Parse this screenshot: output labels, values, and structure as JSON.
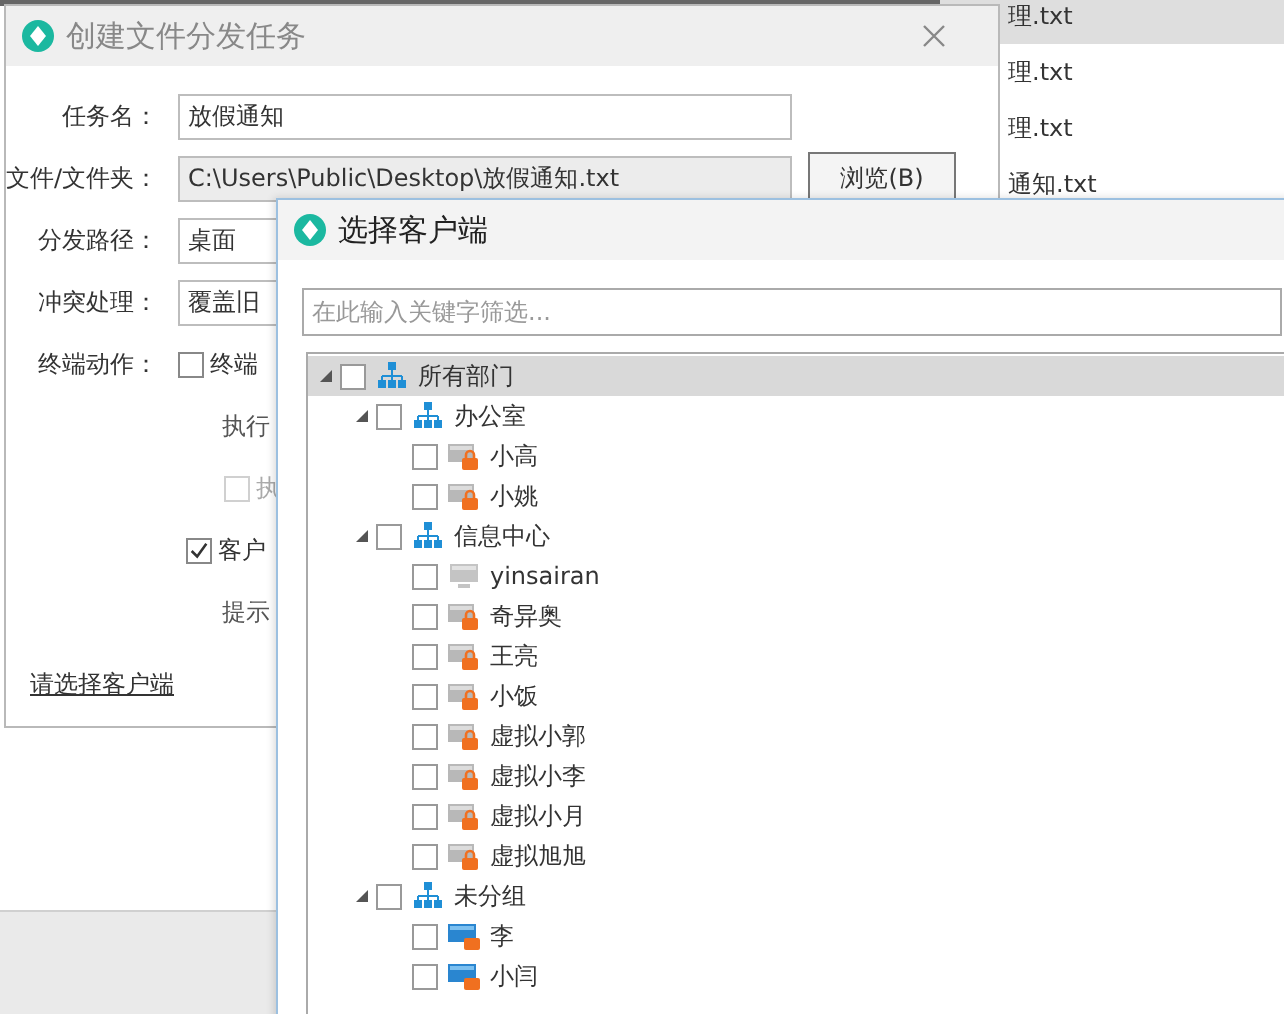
{
  "file_list": {
    "rows": [
      {
        "name": "理.txt",
        "selected": true
      },
      {
        "name": "理.txt",
        "selected": false
      },
      {
        "name": "理.txt",
        "selected": false
      },
      {
        "name": "通知.txt",
        "selected": false
      }
    ]
  },
  "task_dialog": {
    "title": "创建文件分发任务",
    "fields": [
      {
        "label": "任务名：",
        "value": "放假通知",
        "kind": "text"
      },
      {
        "label": "文件/文件夹：",
        "value": "C:\\Users\\Public\\Desktop\\放假通知.txt",
        "kind": "readonly",
        "button": "浏览(B)"
      },
      {
        "label": "分发路径：",
        "value": "桌面",
        "kind": "select"
      },
      {
        "label": "冲突处理：",
        "value": "覆盖旧",
        "kind": "select"
      }
    ],
    "terminal_action": {
      "label": "终端动作：",
      "checkbox": {
        "label": "终端",
        "checked": false
      }
    },
    "execute_label": "执行",
    "execute_checkbox": {
      "label": "执",
      "checked": false,
      "disabled": true
    },
    "client_checkbox": {
      "label": "客户",
      "checked": true
    },
    "prompt_label": "提示",
    "select_clients_link": "请选择客户端"
  },
  "client_dialog": {
    "title": "选择客户端",
    "search": {
      "placeholder": "在此输入关键字筛选..."
    },
    "tree": [
      {
        "label": "所有部门",
        "kind": "group",
        "checked": false,
        "expanded": true,
        "selected": true,
        "children": [
          {
            "label": "办公室",
            "kind": "group",
            "checked": false,
            "expanded": true,
            "selected": false,
            "children": [
              {
                "label": "小高",
                "kind": "locked-client",
                "checked": false,
                "selected": false
              },
              {
                "label": "小姚",
                "kind": "locked-client",
                "checked": false,
                "selected": false
              }
            ]
          },
          {
            "label": "信息中心",
            "kind": "group",
            "checked": false,
            "expanded": true,
            "selected": false,
            "children": [
              {
                "label": "yinsairan",
                "kind": "offline-client",
                "checked": false,
                "selected": false
              },
              {
                "label": "奇异奥",
                "kind": "locked-client",
                "checked": false,
                "selected": false
              },
              {
                "label": "王亮",
                "kind": "locked-client",
                "checked": false,
                "selected": false
              },
              {
                "label": "小饭",
                "kind": "locked-client",
                "checked": false,
                "selected": false
              },
              {
                "label": "虚拟小郭",
                "kind": "locked-client",
                "checked": false,
                "selected": false
              },
              {
                "label": "虚拟小李",
                "kind": "locked-client",
                "checked": false,
                "selected": false
              },
              {
                "label": "虚拟小月",
                "kind": "locked-client",
                "checked": false,
                "selected": false
              },
              {
                "label": "虚拟旭旭",
                "kind": "locked-client",
                "checked": false,
                "selected": false
              }
            ]
          },
          {
            "label": "未分组",
            "kind": "group",
            "checked": false,
            "expanded": true,
            "selected": false,
            "children": [
              {
                "label": "李",
                "kind": "online-client",
                "checked": false,
                "selected": false
              },
              {
                "label": "小闫",
                "kind": "online-client",
                "checked": false,
                "selected": false
              }
            ]
          }
        ]
      }
    ]
  }
}
